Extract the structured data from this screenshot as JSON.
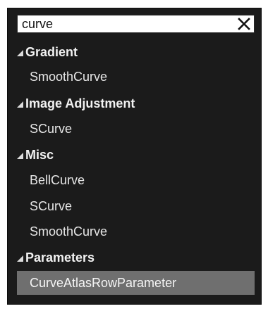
{
  "search": {
    "value": "curve",
    "clear_icon": "close-icon"
  },
  "results": {
    "categories": [
      {
        "label": "Gradient",
        "items": [
          "SmoothCurve"
        ]
      },
      {
        "label": "Image Adjustment",
        "items": [
          "SCurve"
        ]
      },
      {
        "label": "Misc",
        "items": [
          "BellCurve",
          "SCurve",
          "SmoothCurve"
        ]
      },
      {
        "label": "Parameters",
        "items": [
          "CurveAtlasRowParameter"
        ]
      }
    ],
    "selected_item": "CurveAtlasRowParameter"
  },
  "colors": {
    "panel_bg": "#1b1b1b",
    "selection_bg": "#6f6f6f",
    "text": "#e7e7e7"
  }
}
